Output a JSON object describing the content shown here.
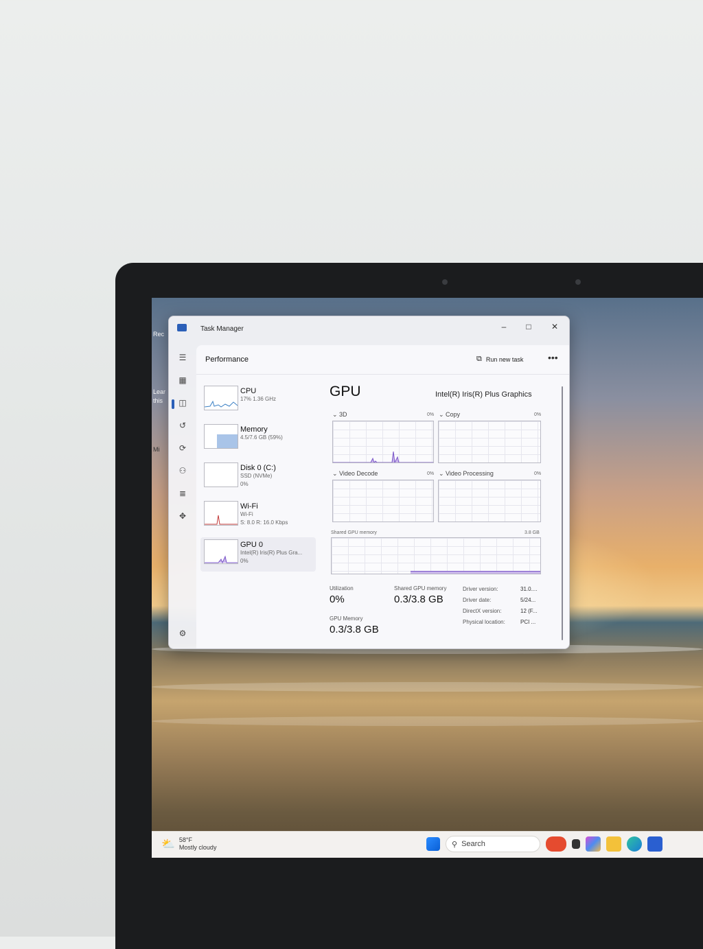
{
  "window": {
    "title": "Task Manager",
    "minimize": "–",
    "maximize": "□",
    "close": "✕"
  },
  "header": {
    "title": "Performance",
    "run_new_task": "Run new task",
    "more": "•••"
  },
  "devices": [
    {
      "name": "CPU",
      "line1": "17%  1.36 GHz",
      "line2": ""
    },
    {
      "name": "Memory",
      "line1": "4.5/7.6 GB (59%)",
      "line2": ""
    },
    {
      "name": "Disk 0 (C:)",
      "line1": "SSD (NVMe)",
      "line2": "0%"
    },
    {
      "name": "Wi-Fi",
      "line1": "Wi-Fi",
      "line2": "S: 8.0  R: 16.0 Kbps"
    },
    {
      "name": "GPU 0",
      "line1": "Intel(R) Iris(R) Plus Gra...",
      "line2": "0%"
    }
  ],
  "detail": {
    "title": "GPU",
    "model": "Intel(R) Iris(R) Plus Graphics",
    "engines": [
      {
        "label": "3D",
        "pct": "0%"
      },
      {
        "label": "Copy",
        "pct": "0%"
      },
      {
        "label": "Video Decode",
        "pct": "0%"
      },
      {
        "label": "Video Processing",
        "pct": "0%"
      }
    ],
    "shared_label": "Shared GPU memory",
    "shared_max": "3.8 GB",
    "utilization_label": "Utilization",
    "utilization_value": "0%",
    "shared_mem_label": "Shared GPU memory",
    "shared_mem_value": "0.3/3.8 GB",
    "gpu_mem_label": "GPU Memory",
    "gpu_mem_value": "0.3/3.8 GB",
    "info": [
      {
        "k": "Driver version:",
        "v": "31.0...."
      },
      {
        "k": "Driver date:",
        "v": "5/24..."
      },
      {
        "k": "DirectX version:",
        "v": "12 (F..."
      },
      {
        "k": "Physical location:",
        "v": "PCI ..."
      }
    ]
  },
  "taskbar": {
    "temp": "58°F",
    "condition": "Mostly cloudy",
    "search": "Search"
  },
  "desktop": {
    "icon1": "Rec",
    "icon2a": "Lear",
    "icon2b": "this",
    "icon3": "Mi"
  }
}
